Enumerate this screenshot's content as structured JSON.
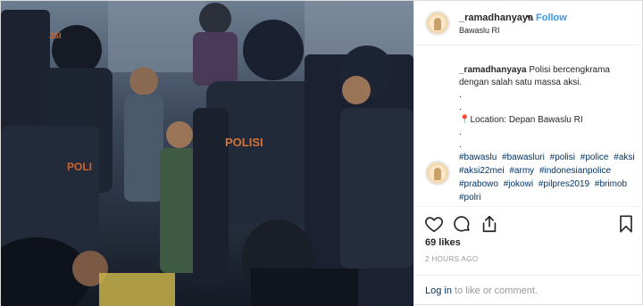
{
  "post": {
    "username": "_ramadhanyaya",
    "follow_label": "Follow",
    "separator": "•",
    "location": "Bawaslu RI",
    "caption_username": "_ramadhanyaya",
    "caption_text": "Polisi bercengkrama dengan salah satu massa aksi.\n.\n.",
    "location_line": "Location: Depan Bawaslu RI",
    "caption_dots_after": ".\n.",
    "hashtags": [
      "#bawaslu",
      "#bawasluri",
      "#polisi",
      "#police",
      "#aksi",
      "#aksi22mei",
      "#army",
      "#indonesianpolice",
      "#prabowo",
      "#jokowi",
      "#pilpres2019",
      "#brimob",
      "#polri"
    ],
    "likes": "69 likes",
    "time": "2 HOURS AGO",
    "login_link": "Log in",
    "login_rest": " to like or comment."
  },
  "photo": {
    "shield_text_left": "POLI",
    "vest_text": "POLISI",
    "shield_text_top": "JSI"
  },
  "icons": {
    "heart": "heart-icon",
    "comment": "comment-icon",
    "share": "share-icon",
    "bookmark": "bookmark-icon",
    "pin": "location-pin-icon"
  },
  "colors": {
    "link_blue": "#3897f0",
    "hashtag_blue": "#003569",
    "muted": "#999999",
    "pin_red": "#ed4956"
  }
}
